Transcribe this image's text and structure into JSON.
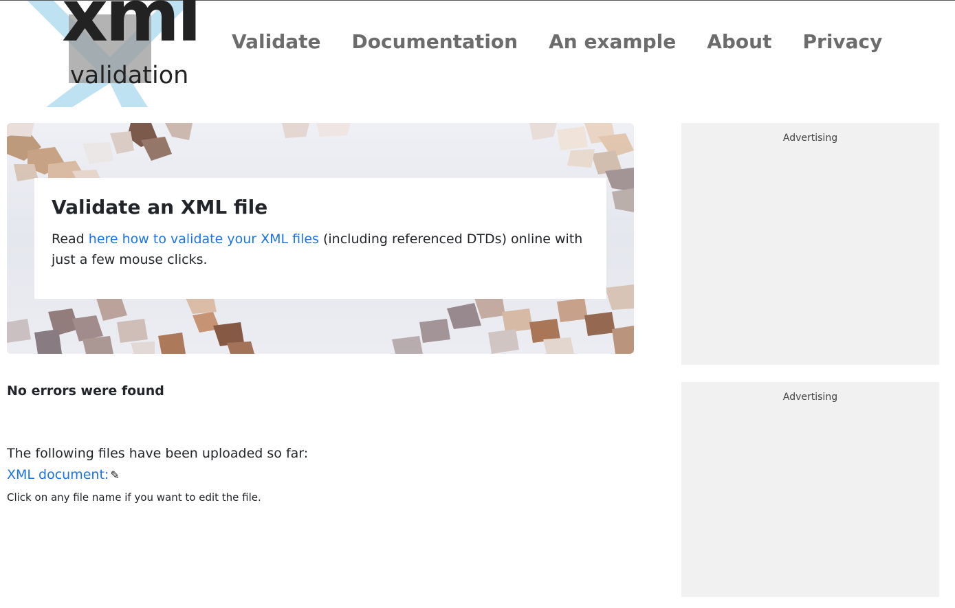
{
  "logo": {
    "title": "xml",
    "subtitle": "validation",
    "colors": {
      "cross": "#bfe2f2",
      "text": "#222222",
      "box": "#8a8a8a"
    }
  },
  "nav": {
    "items": [
      {
        "label": "Validate"
      },
      {
        "label": "Documentation"
      },
      {
        "label": "An example"
      },
      {
        "label": "About"
      },
      {
        "label": "Privacy"
      }
    ]
  },
  "hero": {
    "title": "Validate an XML file",
    "text_before": "Read ",
    "link_text": "here how to validate your XML files",
    "text_after": " (including referenced DTDs) online with just a few mouse clicks."
  },
  "main": {
    "status": "No errors were found",
    "uploaded_label": "The following files have been uploaded so far:",
    "file_link": "XML document:",
    "file_icon": "pencil-icon",
    "hint": "Click on any file name if you want to edit the file."
  },
  "ads": [
    {
      "label": "Advertising"
    },
    {
      "label": "Advertising"
    }
  ],
  "colors": {
    "link": "#1a73e8",
    "nav": "#6c6c6c",
    "ad_bg": "#f1f1f1"
  }
}
